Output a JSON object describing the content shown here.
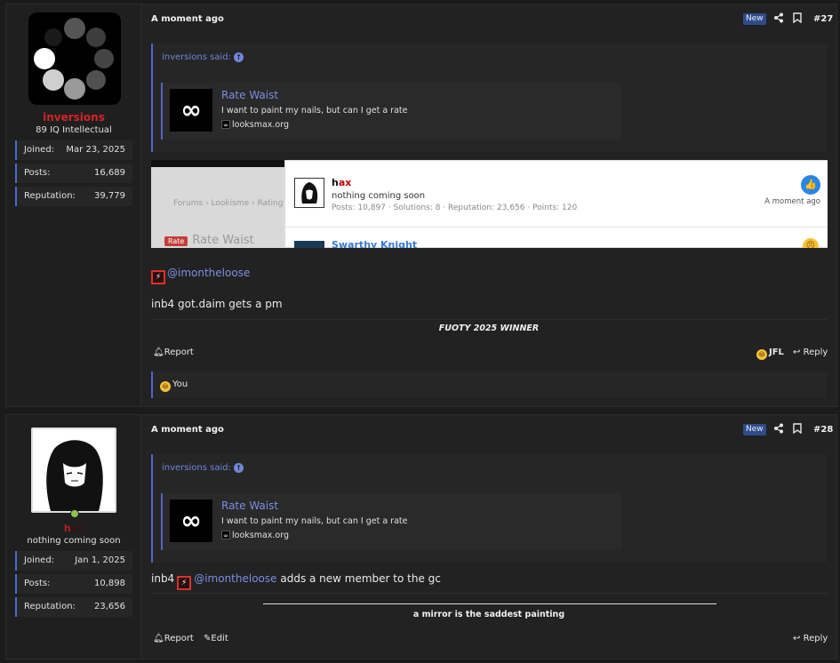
{
  "posts": [
    {
      "user": {
        "name": "inversions",
        "title": "89 IQ Intellectual",
        "stats": [
          {
            "label": "Joined:",
            "value": "Mar 23, 2025"
          },
          {
            "label": "Posts:",
            "value": "16,689"
          },
          {
            "label": "Reputation:",
            "value": "39,779"
          }
        ],
        "avatar_icon": "loading-spinner-icon"
      },
      "time": "A moment ago",
      "badge": "New",
      "number": "#27",
      "quote": {
        "author": "inversions said:",
        "embed": {
          "title": "Rate Waist",
          "desc": "I want to paint my nails, but can I get a rate",
          "site": "looksmax.org",
          "logo": "∞"
        }
      },
      "screenshot": {
        "bg_text": "Forums  ›  Lookisme  ›  Rating",
        "bg_tag": "Rate",
        "bg_name": "Rate Waist",
        "card": {
          "name_prefix": "h",
          "name_suffix": "ax",
          "subtitle": "nothing coming soon",
          "stats": "Posts: 10,897 · Solutions: 8 · Reputation: 23,656 · Points: 120",
          "time": "A moment ago",
          "like_icon": "👍",
          "next_name": "Swarthy Knight",
          "next_emoji": "😠"
        }
      },
      "mention": "@imontheloose",
      "body": "inb4 got.daim gets a pm",
      "signature": "FUOTY 2025 WINNER",
      "actions": {
        "report": "Report",
        "jfl": "JFL",
        "reply": "Reply"
      },
      "reactions": "You"
    },
    {
      "user": {
        "name_prefix": "h",
        "name_suffix": "ax",
        "title": "nothing coming soon",
        "stats": [
          {
            "label": "Joined:",
            "value": "Jan 1, 2025"
          },
          {
            "label": "Posts:",
            "value": "10,898"
          },
          {
            "label": "Reputation:",
            "value": "23,656"
          }
        ]
      },
      "time": "A moment ago",
      "badge": "New",
      "number": "#28",
      "quote": {
        "author": "inversions said:",
        "embed": {
          "title": "Rate Waist",
          "desc": "I want to paint my nails, but can I get a rate",
          "site": "looksmax.org",
          "logo": "∞"
        }
      },
      "body_prefix": "inb4",
      "mention": "@imontheloose",
      "body_suffix": "adds a new member to the gc",
      "signature": "a mirror is the saddest painting",
      "actions": {
        "report": "Report",
        "edit": "Edit",
        "reply": "Reply"
      }
    }
  ],
  "colors": {
    "accent": "#5265c6",
    "username_red": "#d3242c",
    "link": "#7a8fe0"
  }
}
